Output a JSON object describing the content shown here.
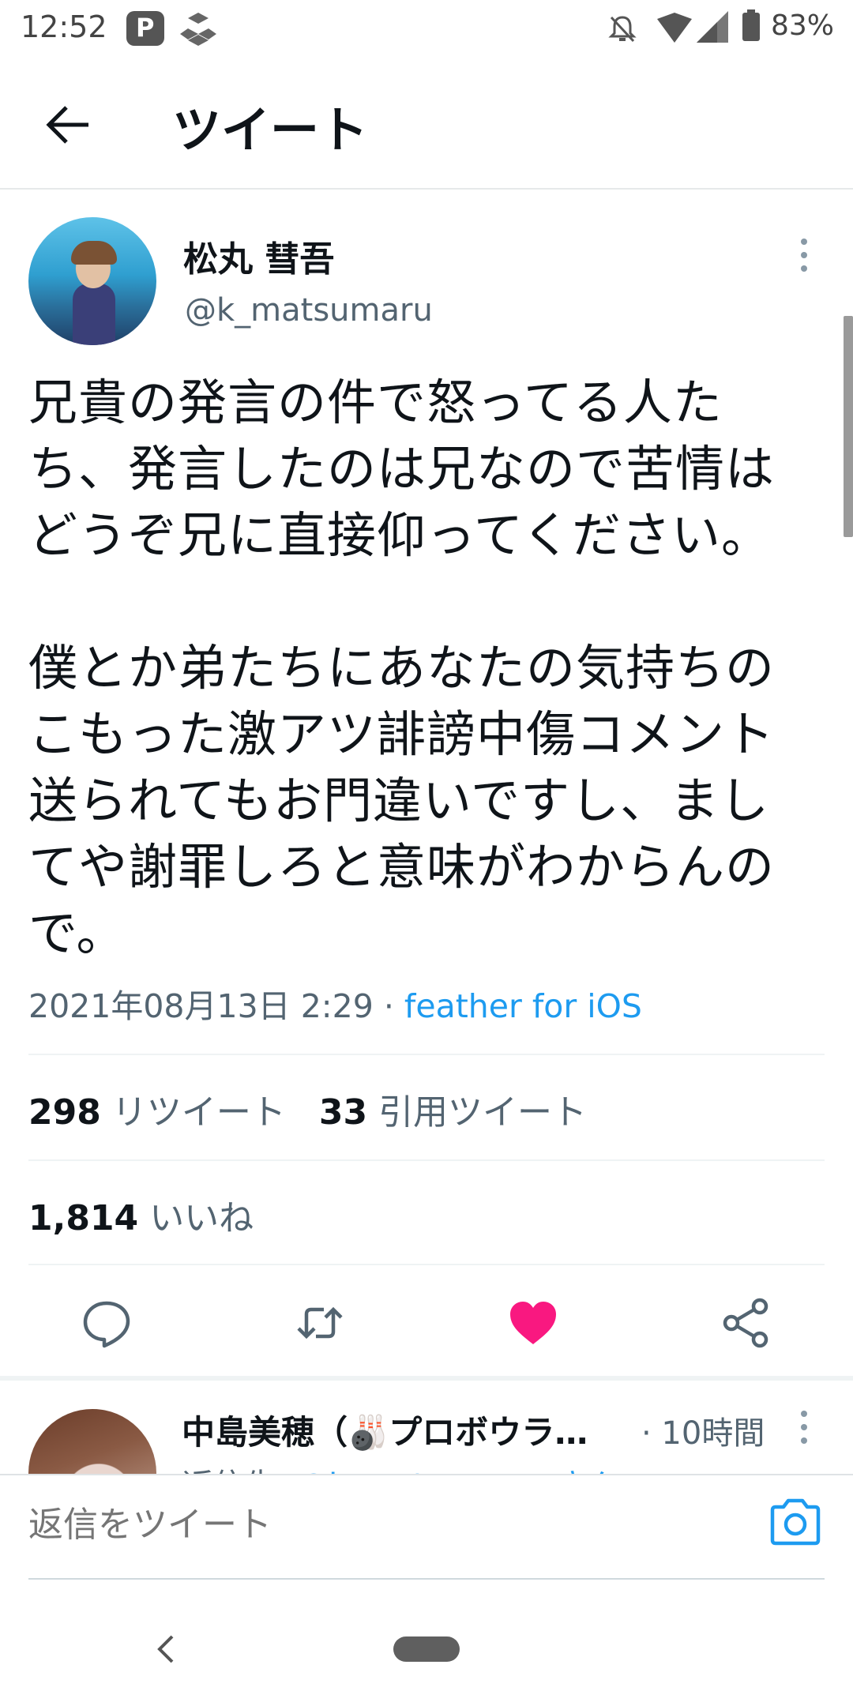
{
  "status_bar": {
    "time": "12:52",
    "paypay_glyph": "P",
    "battery": "83%"
  },
  "header": {
    "title": "ツイート"
  },
  "tweet": {
    "author_name": "松丸 彗吾",
    "author_handle": "@k_matsumaru",
    "text": "兄貴の発言の件で怒ってる人た\nち、発言したのは兄なので苦情は\nどうぞ兄に直接仰ってください。\n\n僕とか弟たちにあなたの気持ちの\nこもった激アツ誹謗中傷コメント\n送られてもお門違いですし、まし\nてや謝罪しろと意味がわからんの\nで。",
    "timestamp": "2021年08月13日 2:29",
    "separator": " · ",
    "source": "feather for iOS",
    "retweets_count": "298",
    "retweets_label": "リツイート",
    "quotes_count": "33",
    "quotes_label": "引用ツイート",
    "likes_count": "1,814",
    "likes_label": "いいね"
  },
  "reply_preview": {
    "name": "中島美穂（🎳プロボウラ…",
    "time": "· 10時間",
    "sub_prefix": "返信先: ",
    "sub_link": "@k_matsumaru さん"
  },
  "compose": {
    "placeholder": "返信をツイート"
  },
  "colors": {
    "accent": "#1d9bf0",
    "like": "#f91880",
    "text": "#0f1419",
    "secondary": "#536471"
  },
  "icons": [
    "back-arrow-icon",
    "more-vertical-icon",
    "reply-icon",
    "retweet-icon",
    "heart-icon",
    "share-icon",
    "camera-icon"
  ]
}
